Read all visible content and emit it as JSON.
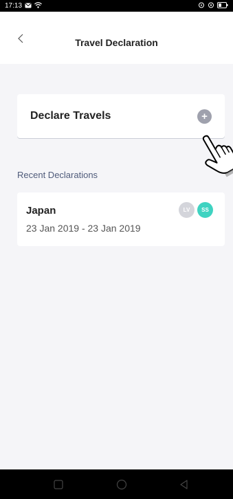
{
  "status_bar": {
    "time": "17:13",
    "left_icons": [
      "message-icon",
      "wifi-icon"
    ],
    "right_icons": [
      "signal-icon",
      "location-icon",
      "battery-icon"
    ]
  },
  "header": {
    "title": "Travel Declaration",
    "back_icon": "chevron-left-icon"
  },
  "declare_card": {
    "label": "Declare Travels",
    "add_glyph": "+"
  },
  "recent": {
    "section_title": "Recent Declarations",
    "items": [
      {
        "country": "Japan",
        "dates": "23 Jan 2019 - 23 Jan 2019",
        "avatars": [
          {
            "initials": "LV",
            "color": "#d4d5db"
          },
          {
            "initials": "SS",
            "color": "#3fd3c1"
          }
        ]
      }
    ]
  },
  "colors": {
    "background": "#f5f5f8",
    "card": "#ffffff",
    "add_button": "#9fa1ad",
    "section_title": "#4f5b7a",
    "avatar_ss": "#3fd3c1"
  },
  "nav_bar": {
    "buttons": [
      "recent-apps-icon",
      "home-icon",
      "back-icon"
    ]
  }
}
